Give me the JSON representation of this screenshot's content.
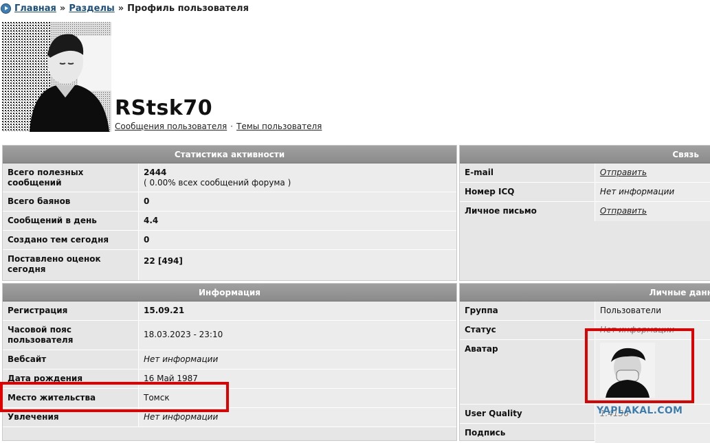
{
  "breadcrumb": {
    "home": "Главная",
    "sections": "Разделы",
    "separator": "»",
    "current": "Профиль пользователя"
  },
  "profile": {
    "username": "RStsk70",
    "links": {
      "messages": "Сообщения пользователя",
      "separator": "·",
      "topics": "Темы пользователя"
    }
  },
  "stats_panel": {
    "title": "Статистика активности",
    "rows": [
      {
        "label": "Всего полезных сообщений",
        "value": "2444",
        "sub": "( 0.00% всех сообщений форума )"
      },
      {
        "label": "Всего баянов",
        "value": "0"
      },
      {
        "label": "Сообщений в день",
        "value": "4.4"
      },
      {
        "label": "Создано тем сегодня",
        "value": "0"
      },
      {
        "label": "Поставлено оценок сегодня",
        "value": "22 [494]"
      }
    ]
  },
  "contact_panel": {
    "title": "Связь",
    "rows": [
      {
        "label": "E-mail",
        "value": "Отправить"
      },
      {
        "label": "Номер ICQ",
        "value": "Нет информации"
      },
      {
        "label": "Личное письмо",
        "value": "Отправить"
      }
    ]
  },
  "info_panel": {
    "title": "Информация",
    "rows": [
      {
        "label": "Регистрация",
        "value": "15.09.21"
      },
      {
        "label": "Часовой пояс пользователя",
        "value": "18.03.2023 - 23:10"
      },
      {
        "label": "Вебсайт",
        "value": "Нет информации"
      },
      {
        "label": "Дата рождения",
        "value": "16 Май 1987"
      },
      {
        "label": "Место жительства",
        "value": "Томск"
      },
      {
        "label": "Увлечения",
        "value": "Нет информации"
      }
    ]
  },
  "personal_panel": {
    "title": "Личные данн",
    "rows": [
      {
        "label": "Группа",
        "value": "Пользователи"
      },
      {
        "label": "Статус",
        "value": "Нет информации"
      },
      {
        "label": "Аватар",
        "value": ""
      },
      {
        "label": "User Quality",
        "value": "1.4136"
      },
      {
        "label": "Подпись",
        "value": ""
      }
    ]
  },
  "watermark": "YAPLAKAL.COM",
  "colors": {
    "link": "#1b4f7c",
    "panel_header": "#8b8b8b",
    "panel_bg": "#e6e6e6",
    "highlight": "#e00000"
  }
}
